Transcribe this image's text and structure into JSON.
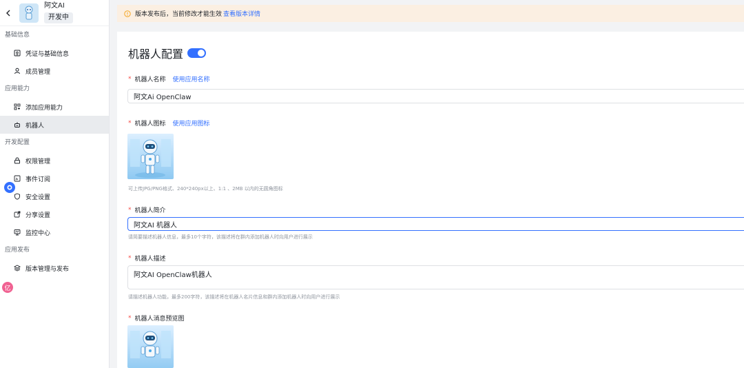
{
  "app": {
    "name": "阿文AI",
    "status": "开发中"
  },
  "sidebar": {
    "sections": [
      {
        "title": "基础信息",
        "items": [
          {
            "label": "凭证与基础信息",
            "icon": "credential-icon"
          },
          {
            "label": "成员管理",
            "icon": "user-icon"
          }
        ]
      },
      {
        "title": "应用能力",
        "items": [
          {
            "label": "添加应用能力",
            "icon": "apps-grid-icon"
          },
          {
            "label": "机器人",
            "icon": "robot-icon",
            "active": true
          }
        ]
      },
      {
        "title": "开发配置",
        "items": [
          {
            "label": "权限管理",
            "icon": "lock-icon"
          },
          {
            "label": "事件订阅",
            "icon": "rss-icon"
          },
          {
            "label": "安全设置",
            "icon": "shield-icon"
          },
          {
            "label": "分享设置",
            "icon": "share-icon"
          },
          {
            "label": "监控中心",
            "icon": "monitor-icon"
          }
        ]
      },
      {
        "title": "应用发布",
        "items": [
          {
            "label": "版本管理与发布",
            "icon": "layers-icon"
          }
        ]
      }
    ],
    "float_badge_2": "亿"
  },
  "notice": {
    "text": "版本发布后，当前修改才能生效",
    "link": "查看版本详情"
  },
  "card": {
    "title": "机器人配置",
    "toggle_on": true,
    "name_field": {
      "label": "机器人名称",
      "link": "使用应用名称",
      "value": "阿文Ai OpenClaw"
    },
    "icon_field": {
      "label": "机器人图标",
      "link": "使用应用图标",
      "hint": "可上传JPG/PNG格式、240*240px以上、1:1 、2MB 以内的无圆角图标"
    },
    "intro_field": {
      "label": "机器人简介",
      "value": "阿文AI 机器人",
      "hint": "请简要描述机器人信息，最多10个字符，该描述将在群内添加机器人时向用户进行展示"
    },
    "desc_field": {
      "label": "机器人描述",
      "value": "阿文AI OpenClaw机器人",
      "hint": "请描述机器人功能，最多200字符，该描述将在机器人名片信息和群内添加机器人时向用户进行展示"
    },
    "preview_field": {
      "label": "机器人消息预览图"
    }
  },
  "colors": {
    "accent": "#3370ff",
    "required": "#f54a45",
    "notice_bg": "#fbefe2"
  }
}
